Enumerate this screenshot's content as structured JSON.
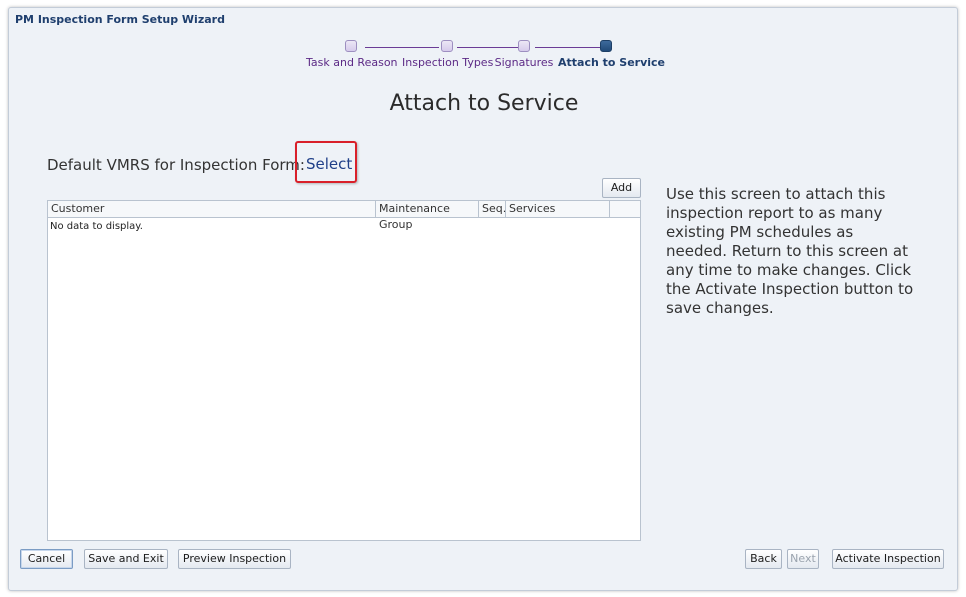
{
  "window": {
    "title": "PM Inspection Form Setup Wizard"
  },
  "train": {
    "steps": [
      {
        "label": "Task and Reason"
      },
      {
        "label": "Inspection Types"
      },
      {
        "label": "Signatures"
      },
      {
        "label": "Attach to Service"
      }
    ]
  },
  "page": {
    "heading": "Attach to Service"
  },
  "vmrs": {
    "label": "Default VMRS for Inspection Form:",
    "link": "Select"
  },
  "table": {
    "add_label": "Add",
    "columns": [
      "Customer",
      "Maintenance Group",
      "Seq.",
      "Services"
    ],
    "empty_text": "No data to display."
  },
  "help_text": "Use this screen to attach this inspection report to as many existing PM schedules as needed. Return to this screen at any time to make changes. Click the Activate Inspection button to save changes.",
  "footer": {
    "cancel": "Cancel",
    "save_exit": "Save and Exit",
    "preview": "Preview Inspection",
    "back": "Back",
    "next": "Next",
    "activate": "Activate Inspection"
  }
}
